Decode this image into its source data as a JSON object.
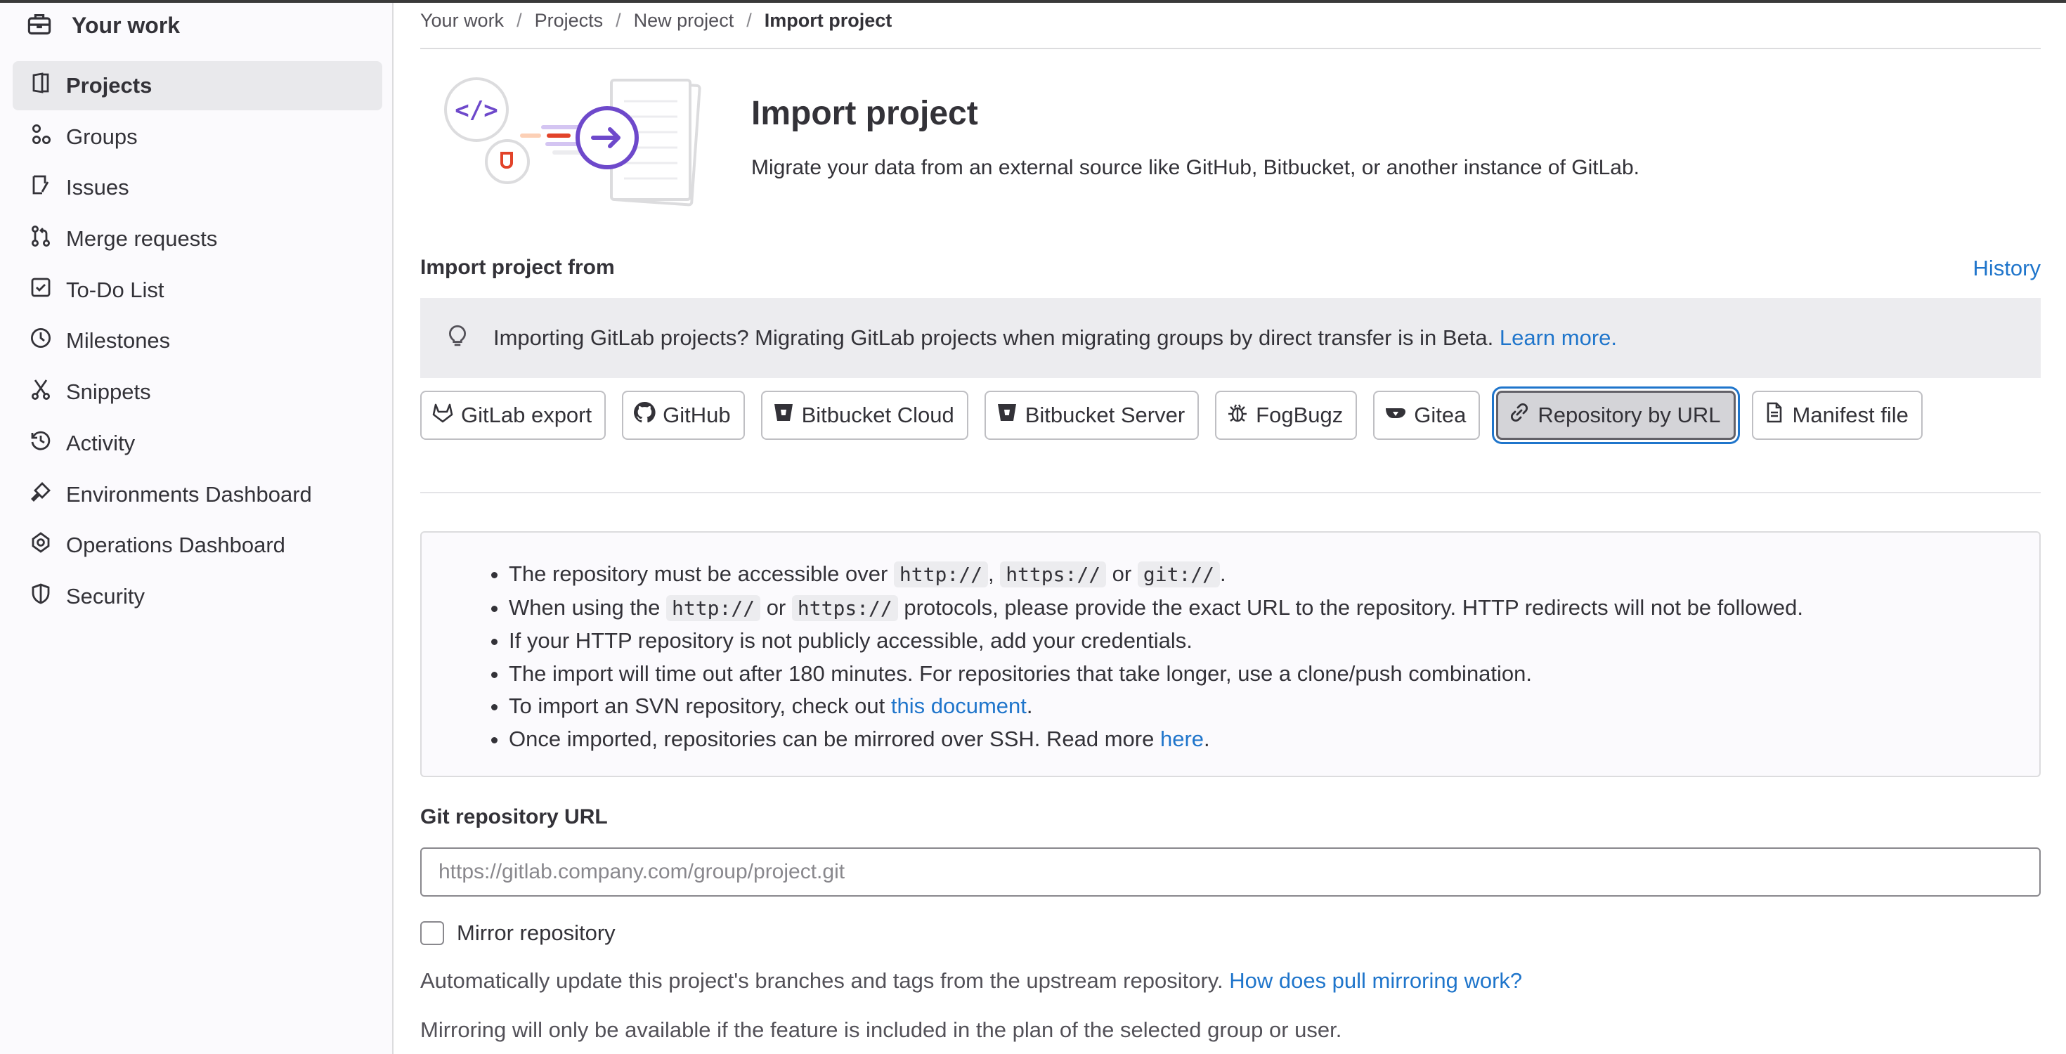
{
  "sidebar": {
    "header_title": "Your work",
    "items": [
      {
        "label": "Projects",
        "icon": "project-icon",
        "active": true
      },
      {
        "label": "Groups",
        "icon": "group-icon"
      },
      {
        "label": "Issues",
        "icon": "issues-icon"
      },
      {
        "label": "Merge requests",
        "icon": "merge-request-icon"
      },
      {
        "label": "To-Do List",
        "icon": "todo-icon"
      },
      {
        "label": "Milestones",
        "icon": "clock-icon"
      },
      {
        "label": "Snippets",
        "icon": "snippet-icon"
      },
      {
        "label": "Activity",
        "icon": "history-icon"
      },
      {
        "label": "Environments Dashboard",
        "icon": "environment-icon"
      },
      {
        "label": "Operations Dashboard",
        "icon": "cloud-gear-icon"
      },
      {
        "label": "Security",
        "icon": "shield-icon"
      }
    ]
  },
  "breadcrumb": {
    "items": [
      "Your work",
      "Projects",
      "New project"
    ],
    "current": "Import project"
  },
  "hero": {
    "title": "Import project",
    "description": "Migrate your data from an external source like GitHub, Bitbucket, or another instance of GitLab."
  },
  "import_section": {
    "title": "Import project from",
    "history_link": "History"
  },
  "alert": {
    "text": "Importing GitLab projects? Migrating GitLab projects when migrating groups by direct transfer is in Beta.",
    "link": "Learn more."
  },
  "sources": [
    {
      "label": "GitLab export",
      "icon": "tanuki-icon"
    },
    {
      "label": "GitHub",
      "icon": "github-icon"
    },
    {
      "label": "Bitbucket Cloud",
      "icon": "bitbucket-icon"
    },
    {
      "label": "Bitbucket Server",
      "icon": "bitbucket-icon"
    },
    {
      "label": "FogBugz",
      "icon": "bug-icon"
    },
    {
      "label": "Gitea",
      "icon": "gitea-icon"
    },
    {
      "label": "Repository by URL",
      "icon": "link-icon",
      "selected": true
    },
    {
      "label": "Manifest file",
      "icon": "document-icon"
    }
  ],
  "info": {
    "line1_pre": "The repository must be accessible over",
    "line1_code1": "http://",
    "line1_comma": ",",
    "line1_code2": "https://",
    "line1_or": "or",
    "line1_code3": "git://",
    "line1_end": ".",
    "line2_pre": "When using the",
    "line2_code1": "http://",
    "line2_or": "or",
    "line2_code2": "https://",
    "line2_post": "protocols, please provide the exact URL to the repository. HTTP redirects will not be followed.",
    "line3": "If your HTTP repository is not publicly accessible, add your credentials.",
    "line4": "The import will time out after 180 minutes. For repositories that take longer, use a clone/push combination.",
    "line5_pre": "To import an SVN repository, check out",
    "line5_link": "this document",
    "line5_end": ".",
    "line6_pre": "Once imported, repositories can be mirrored over SSH. Read more",
    "line6_link": "here",
    "line6_end": "."
  },
  "url_field": {
    "label": "Git repository URL",
    "placeholder": "https://gitlab.company.com/group/project.git",
    "value": ""
  },
  "mirror": {
    "label": "Mirror repository",
    "checked": false,
    "help_text": "Automatically update this project's branches and tags from the upstream repository.",
    "help_link": "How does pull mirroring work?",
    "note": "Mirroring will only be available if the feature is included in the plan of the selected group or user."
  },
  "colors": {
    "link": "#1f75cb",
    "illustration_purple": "#6e49cb",
    "illustration_orange": "#e24329",
    "sidebar_bg": "#fbfafd",
    "alert_bg": "#ececef"
  }
}
